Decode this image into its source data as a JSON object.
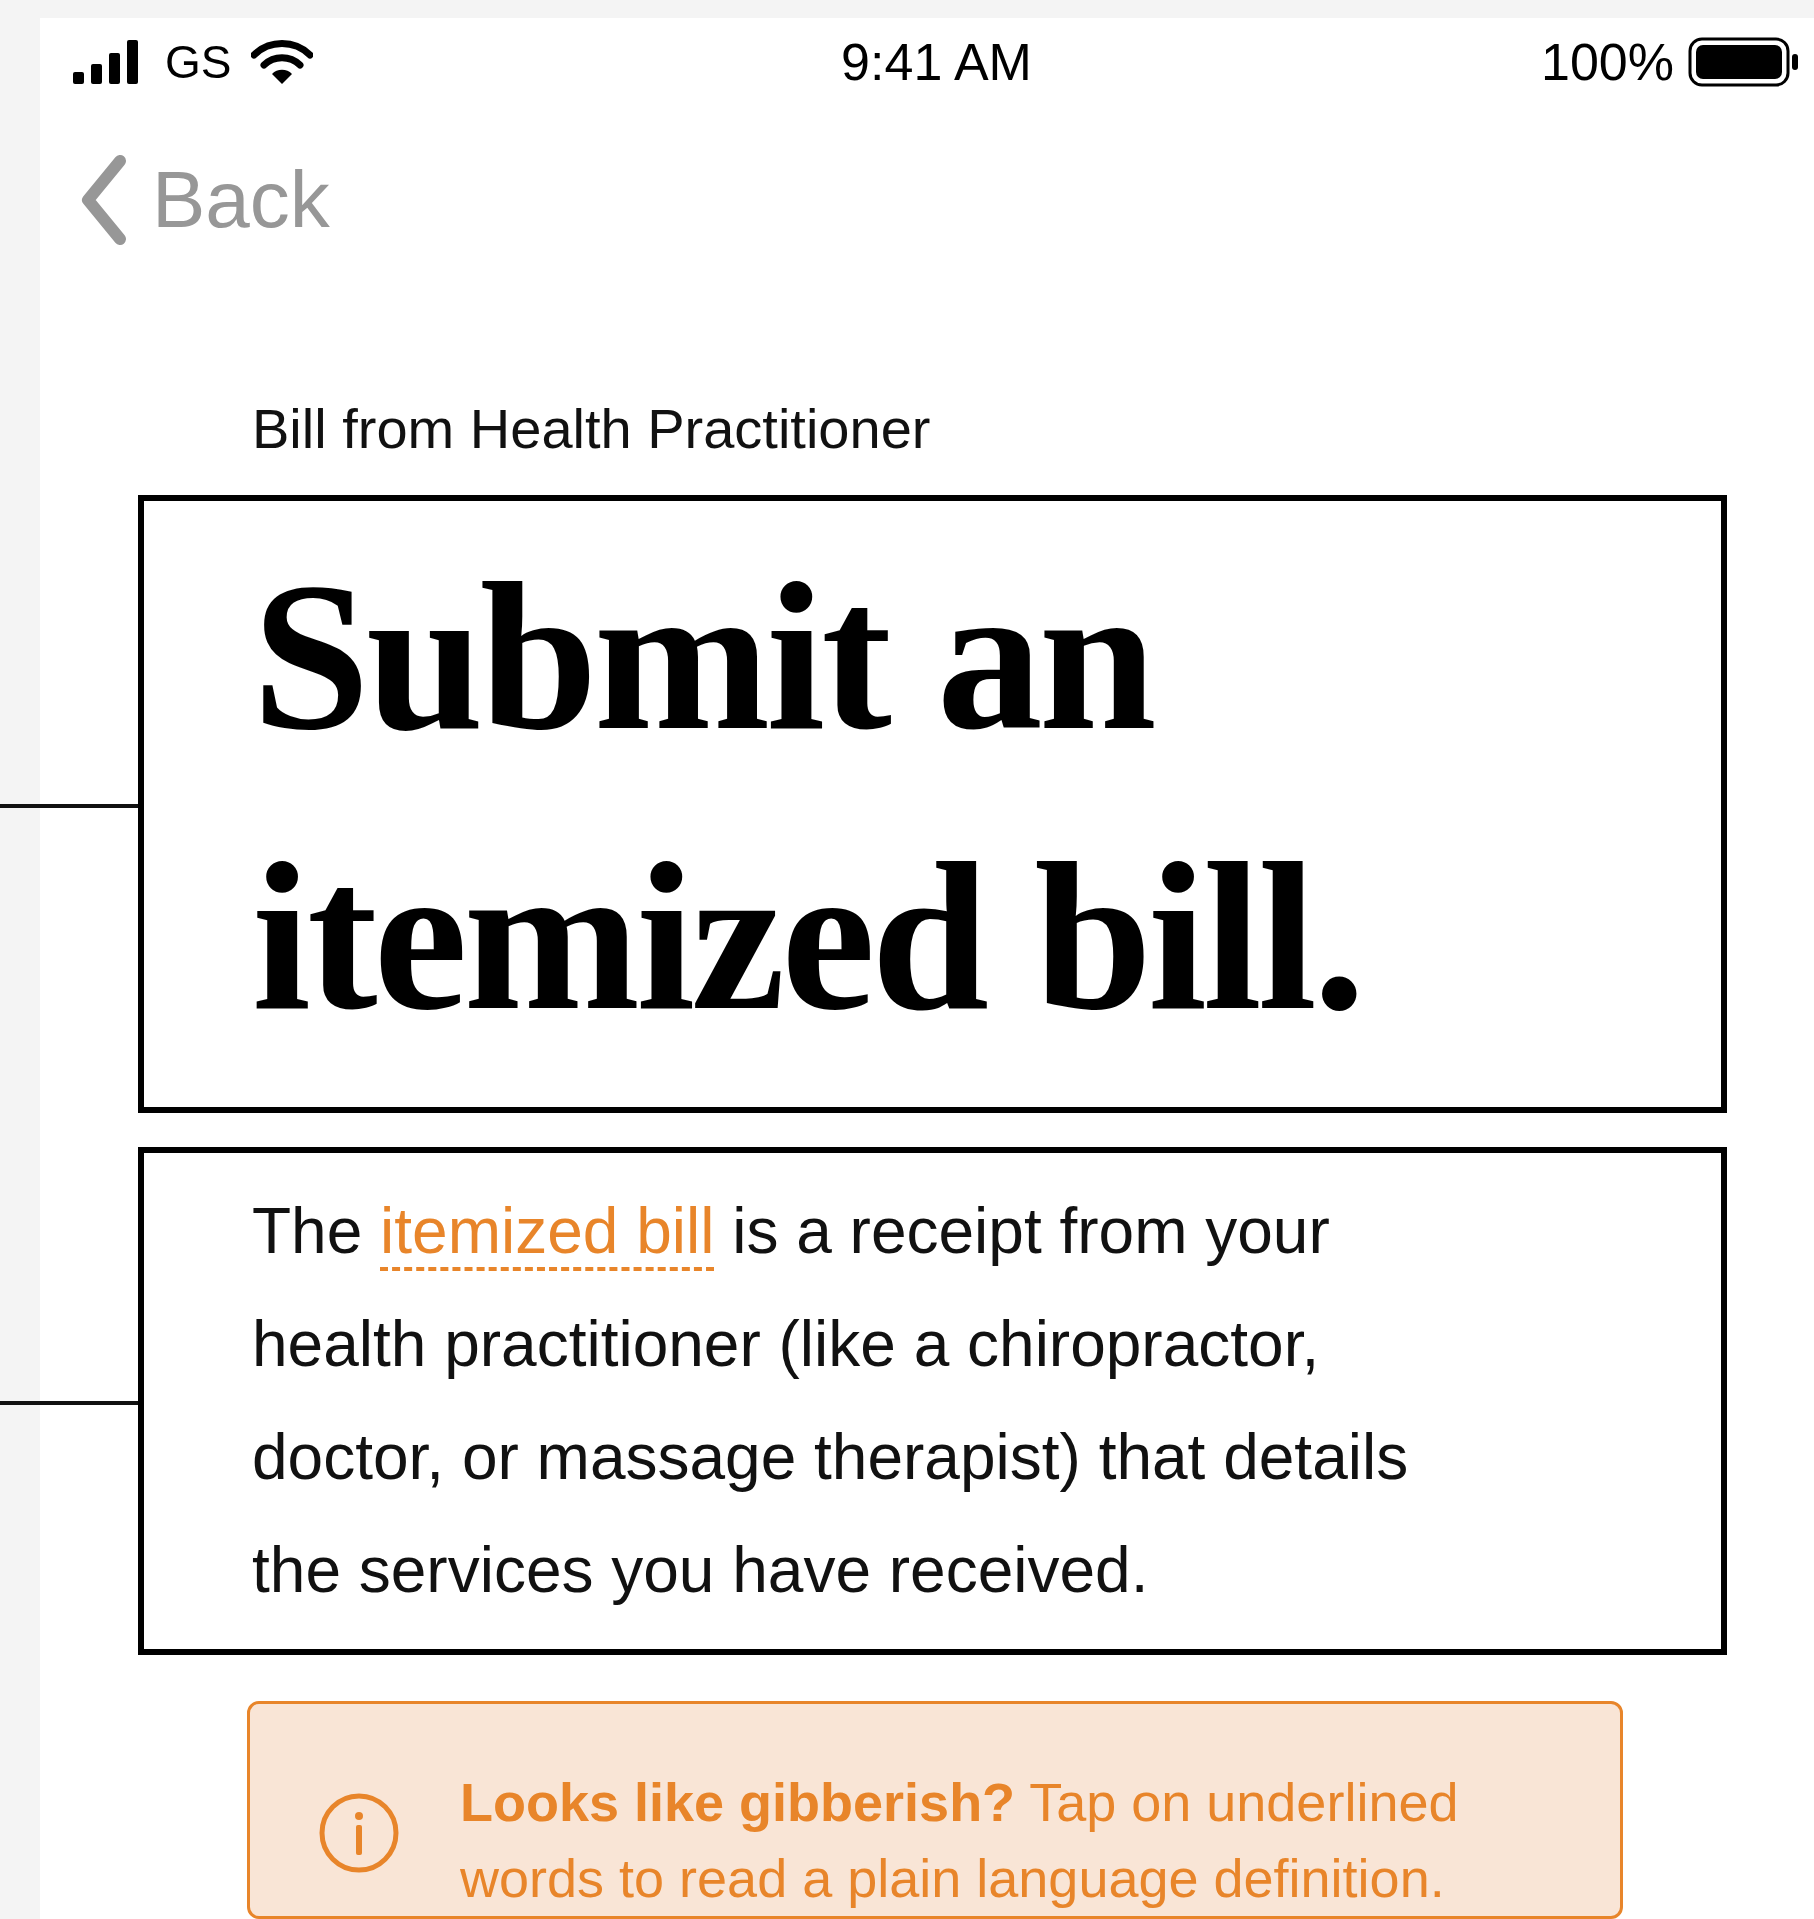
{
  "status_bar": {
    "carrier": "GS",
    "time": "9:41 AM",
    "battery": "100%"
  },
  "nav": {
    "back": "Back"
  },
  "eyebrow": "Bill from Health Practitioner",
  "title": "Submit an itemized bill.",
  "body": [
    {
      "kind": "text",
      "text": "The "
    },
    {
      "kind": "term",
      "text": "itemized bill"
    },
    {
      "kind": "text",
      "text": " is a receipt from your health practitioner (like a chiropractor, doctor, or massage therapist) that details the services you have received."
    }
  ],
  "tip": "**Looks like gibberish?** Tap on underlined words to read a plain language definition."
}
